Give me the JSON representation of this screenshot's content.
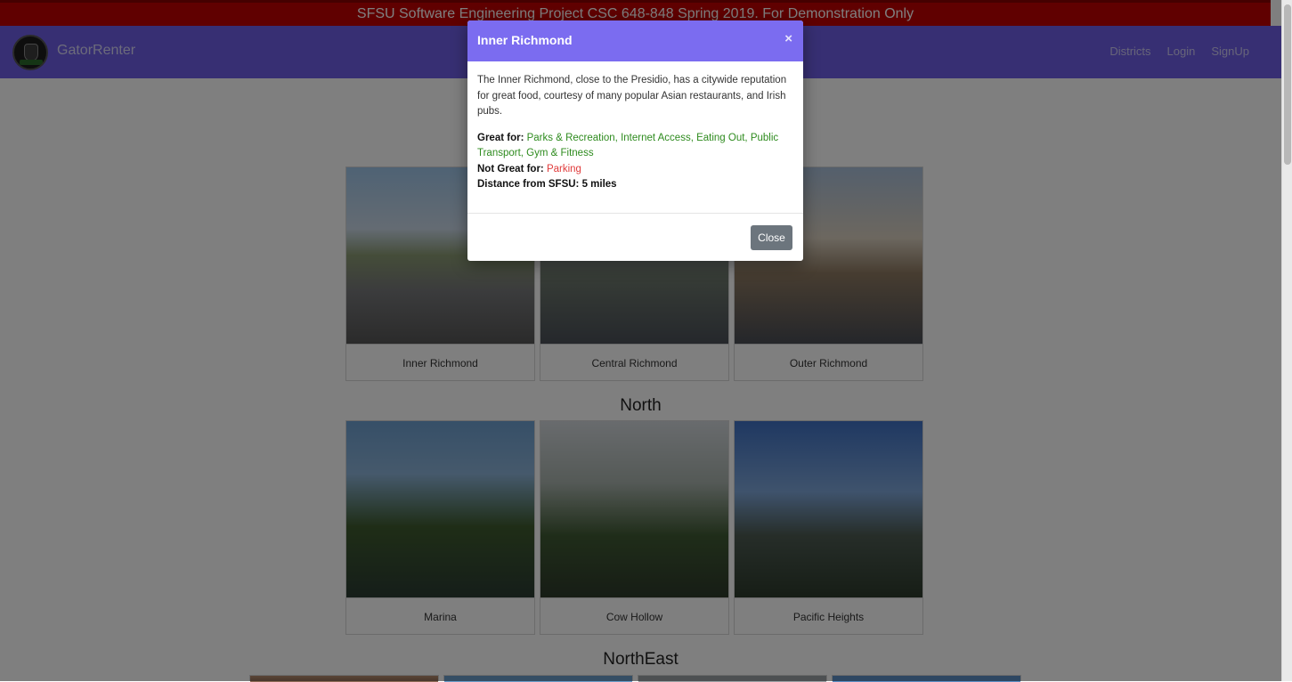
{
  "banner": {
    "text": "SFSU Software Engineering Project CSC 648-848 Spring 2019. For Demonstration Only"
  },
  "navbar": {
    "brand": "GatorRenter",
    "links": [
      "Districts",
      "Login",
      "SignUp"
    ]
  },
  "sections": [
    {
      "title": "",
      "cards": [
        {
          "label": "Inner Richmond"
        },
        {
          "label": "Central Richmond"
        },
        {
          "label": "Outer Richmond"
        }
      ]
    },
    {
      "title": "North",
      "cards": [
        {
          "label": "Marina"
        },
        {
          "label": "Cow Hollow"
        },
        {
          "label": "Pacific Heights"
        }
      ]
    },
    {
      "title": "NorthEast",
      "cards": []
    }
  ],
  "modal": {
    "title": "Inner Richmond",
    "close_x": "×",
    "description": "The Inner Richmond, close to the Presidio, has a citywide reputation for great food, courtesy of many popular Asian restaurants, and Irish pubs.",
    "great_for_label": "Great for:",
    "great_for": "Parks & Recreation, Internet Access, Eating Out, Public Transport, Gym & Fitness",
    "not_great_label": "Not Great for:",
    "not_great_for": "Parking",
    "distance_text": "Distance from SFSU: 5 miles",
    "close_button": "Close"
  },
  "colors": {
    "banner": "#c00000",
    "navbar": "#6f5fe6",
    "modal_header": "#7b6cf0",
    "good": "#2e8b1e",
    "bad": "#e03b3b"
  }
}
